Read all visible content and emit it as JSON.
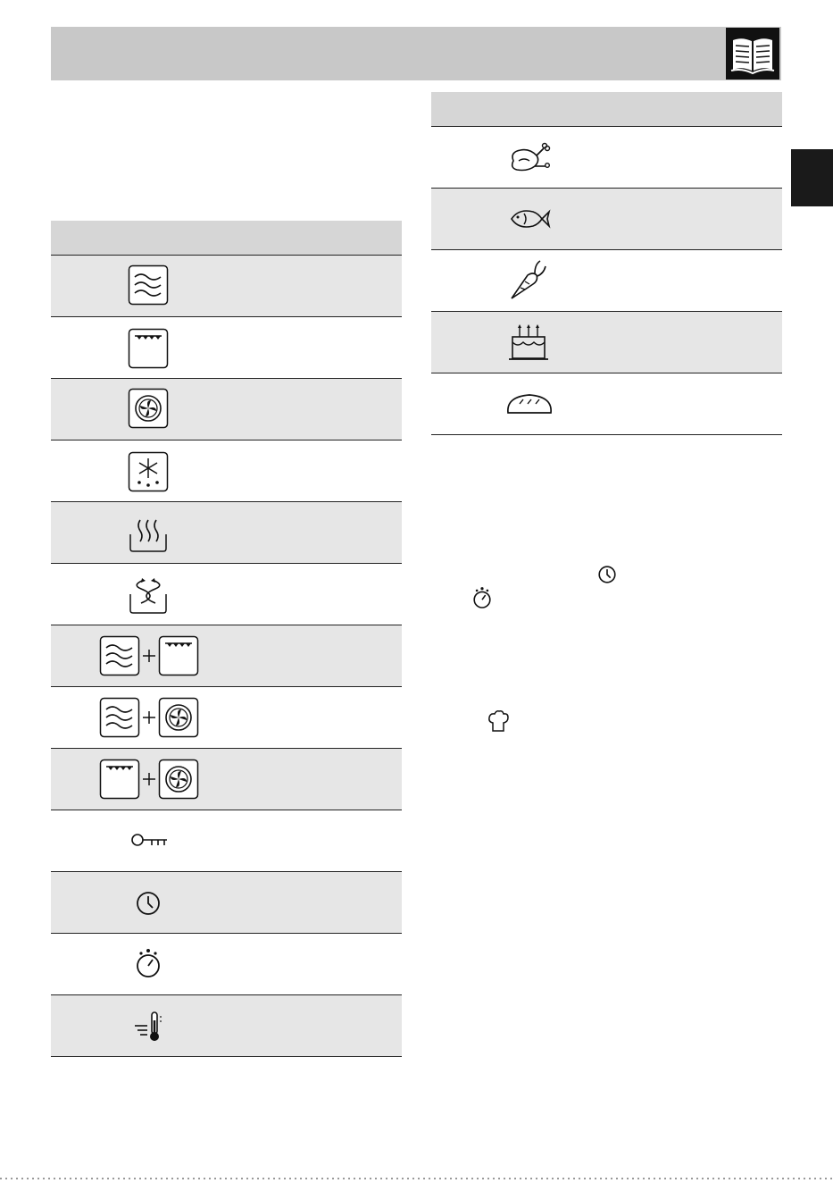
{
  "header": {
    "book_icon": "open-book-icon",
    "header_color": "#c8c8c8"
  },
  "side_tab": {
    "color": "#1a1a1a"
  },
  "symbols_table": {
    "rows": [
      {
        "icon": "microwave-waves-icon",
        "shaded": true
      },
      {
        "icon": "top-heating-element-icon",
        "shaded": false
      },
      {
        "icon": "fan-assisted-icon",
        "shaded": true
      },
      {
        "icon": "defrost-snowflake-icon",
        "shaded": false
      },
      {
        "icon": "steam-icon",
        "shaded": true
      },
      {
        "icon": "reheat-arrows-icon",
        "shaded": false
      },
      {
        "icon": "microwave-plus-grill-icon",
        "shaded": true
      },
      {
        "icon": "microwave-plus-fan-icon",
        "shaded": false
      },
      {
        "icon": "grill-plus-fan-icon",
        "shaded": true
      },
      {
        "icon": "key-lock-icon",
        "shaded": false
      },
      {
        "icon": "clock-icon",
        "shaded": true
      },
      {
        "icon": "timer-stopwatch-icon",
        "shaded": false
      },
      {
        "icon": "temperature-probe-icon",
        "shaded": true
      }
    ]
  },
  "food_table": {
    "rows": [
      {
        "icon": "poultry-chicken-icon",
        "shaded": false
      },
      {
        "icon": "fish-icon",
        "shaded": true
      },
      {
        "icon": "vegetable-carrot-icon",
        "shaded": false
      },
      {
        "icon": "cake-icon",
        "shaded": true
      },
      {
        "icon": "bread-icon",
        "shaded": false
      }
    ]
  },
  "inline_icons": [
    "clock-icon",
    "timer-stopwatch-icon",
    "chef-hat-icon"
  ]
}
